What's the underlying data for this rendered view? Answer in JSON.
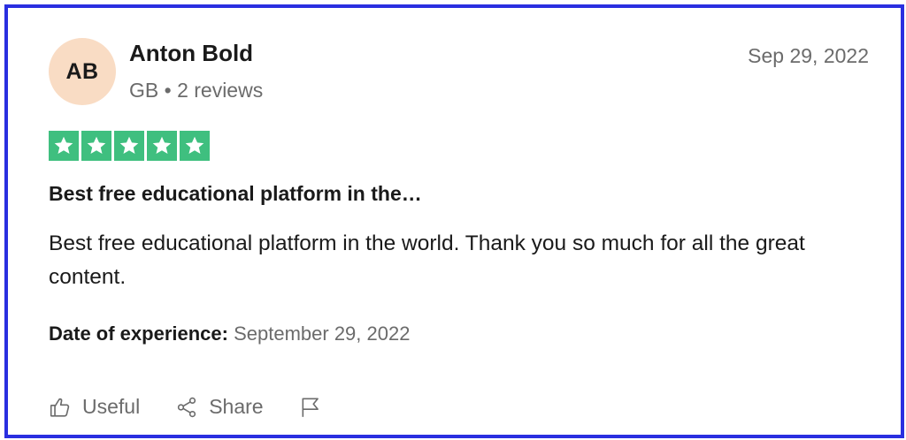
{
  "reviewer": {
    "initials": "AB",
    "name": "Anton Bold",
    "meta": "GB • 2 reviews"
  },
  "review": {
    "date": "Sep 29, 2022",
    "rating": 5,
    "rating_max": 5,
    "title": "Best free educational platform in the…",
    "body": "Best free educational platform in the world. Thank you so much for all the great content.",
    "experience_label": "Date of experience:",
    "experience_value": "September 29, 2022"
  },
  "actions": {
    "useful_label": "Useful",
    "share_label": "Share",
    "useful_icon": "thumbs-up-icon",
    "share_icon": "share-icon",
    "report_icon": "flag-icon"
  },
  "colors": {
    "border": "#2a2fe0",
    "star_fill": "#3fbf7f",
    "avatar_bg": "#f9dcc4",
    "muted_text": "#6b6b6b"
  }
}
